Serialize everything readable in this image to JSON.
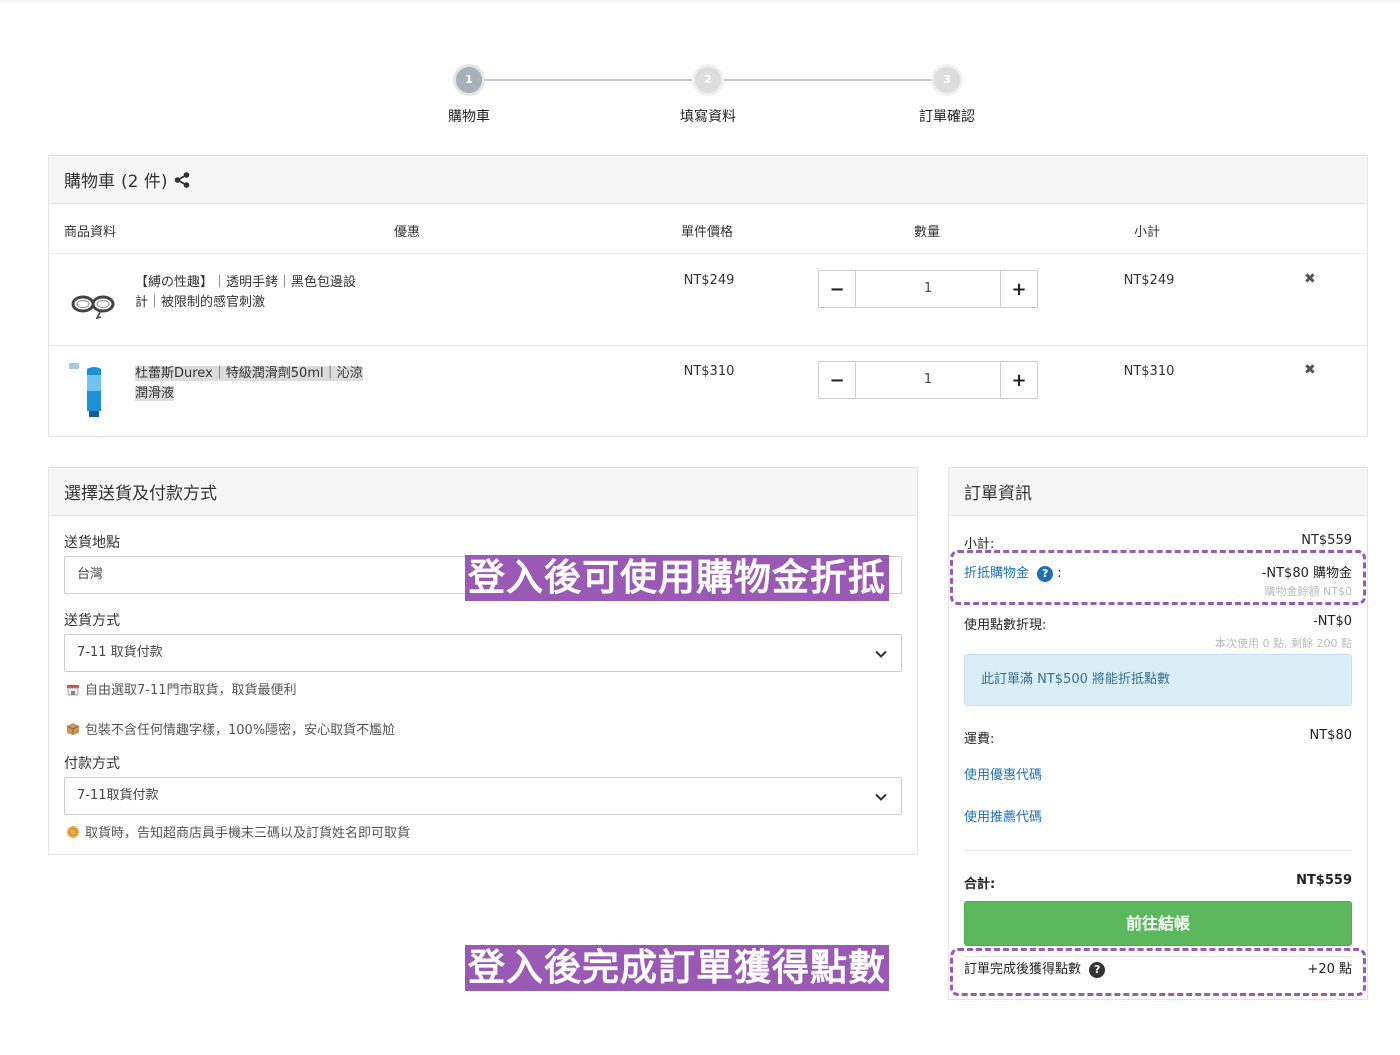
{
  "stepper": {
    "steps": [
      {
        "number": "1",
        "label": "購物車"
      },
      {
        "number": "2",
        "label": "填寫資料"
      },
      {
        "number": "3",
        "label": "訂單確認"
      }
    ]
  },
  "cart": {
    "title": "購物車",
    "count": "(2 件)",
    "headers": {
      "product": "商品資料",
      "discount": "優惠",
      "unit_price": "單件價格",
      "quantity": "數量",
      "subtotal": "小計"
    },
    "items": [
      {
        "name": "【縛の性趣】｜透明手銬｜黑色包邊設計｜被限制的感官刺激",
        "price": "NT$249",
        "qty": "1",
        "subtotal": "NT$249"
      },
      {
        "name": "杜蕾斯Durex｜特級潤滑劑50ml｜沁涼潤滑液",
        "price": "NT$310",
        "qty": "1",
        "subtotal": "NT$310"
      }
    ],
    "minus": "−",
    "plus": "+",
    "remove": "✖"
  },
  "shipping": {
    "title": "選擇送貨及付款方式",
    "destination_label": "送貨地點",
    "destination_value": "台灣",
    "method_label": "送貨方式",
    "method_value": "7-11 取貨付款",
    "note1": "自由選取7-11門市取貨，取貨最便利",
    "note2": "包裝不含任何情趣字樣，100%隱密，安心取貨不尷尬",
    "payment_label": "付款方式",
    "payment_value": "7-11取貨付款",
    "note3": "取貨時，告知超商店員手機末三碼以及訂貨姓名即可取貨"
  },
  "order": {
    "title": "訂單資訊",
    "subtotal_label": "小計:",
    "subtotal_value": "NT$559",
    "credit_label": "折抵購物金",
    "credit_colon": ":",
    "credit_value": "-NT$80 購物金",
    "credit_balance": "購物金餘額 NT$0",
    "points_label": "使用點數折現:",
    "points_value": "-NT$0",
    "points_note": "本次使用 0 點, 剩餘 200 點",
    "alert": "此訂單滿 NT$500 將能折抵點數",
    "shipping_label": "運費:",
    "shipping_value": "NT$80",
    "coupon_link": "使用優惠代碼",
    "referral_link": "使用推薦代碼",
    "total_label": "合計:",
    "total_value": "NT$559",
    "checkout": "前往結帳",
    "earn_label": "訂單完成後獲得點數",
    "earn_value": "+20 點",
    "qmark": "?"
  },
  "annotations": {
    "banner1": "登入後可使用購物金折抵",
    "banner2": "登入後完成訂單獲得點數"
  },
  "colors": {
    "accent_purple": "#9b59b6",
    "checkout_green": "#5cb85c",
    "link_blue": "#1f6fb2",
    "alert_bg": "#daeef7"
  }
}
